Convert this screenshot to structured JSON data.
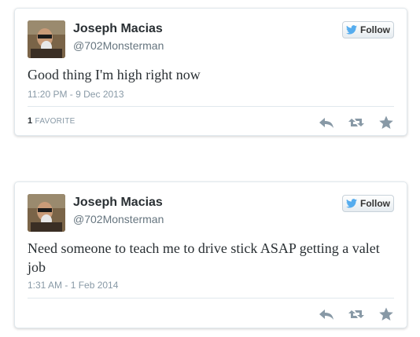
{
  "tweets": [
    {
      "author_name": "Joseph Macias",
      "handle": "@702Monsterman",
      "follow_label": "Follow",
      "text": "Good thing I'm high right now",
      "timestamp": "11:20 PM - 9 Dec 2013",
      "favorite_count": "1",
      "favorite_label": "FAVORITE"
    },
    {
      "author_name": "Joseph Macias",
      "handle": "@702Monsterman",
      "follow_label": "Follow",
      "text": "Need someone to teach me to drive stick ASAP getting a valet job",
      "timestamp": "1:31 AM - 1 Feb 2014"
    }
  ],
  "icons": {
    "follow": "twitter-bird-icon",
    "reply": "reply-icon",
    "retweet": "retweet-icon",
    "favorite": "star-icon"
  },
  "colors": {
    "bird_blue": "#55acee",
    "action_gray": "#8899a6",
    "text_dark": "#292f33"
  }
}
